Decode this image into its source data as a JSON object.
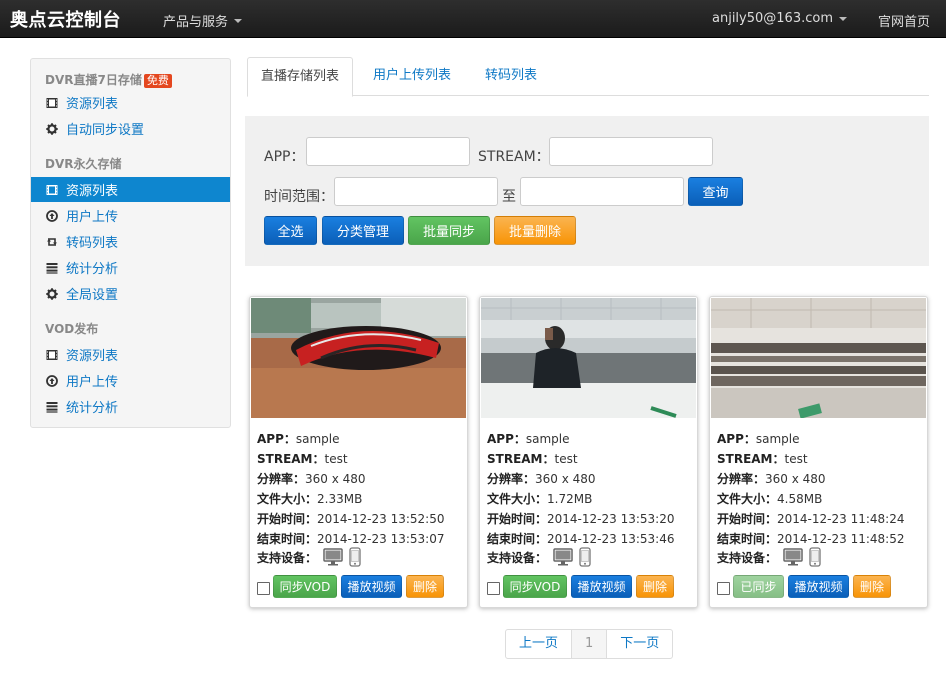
{
  "nav": {
    "brand": "奥点云控制台",
    "products": "产品与服务",
    "user": "anjily50@163.com",
    "home": "官网首页"
  },
  "sidebar": {
    "dvr7_header": "DVR直播7日存储",
    "dvr7_badge": "免费",
    "dvr7_items": [
      {
        "label": "资源列表",
        "icon": "film-icon"
      },
      {
        "label": "自动同步设置",
        "icon": "gear-icon"
      }
    ],
    "dvr_perm_header": "DVR永久存储",
    "dvr_perm_items": [
      {
        "label": "资源列表",
        "icon": "film-icon",
        "active": true
      },
      {
        "label": "用户上传",
        "icon": "upload-circle-icon"
      },
      {
        "label": "转码列表",
        "icon": "retweet-icon"
      },
      {
        "label": "统计分析",
        "icon": "list-icon"
      },
      {
        "label": "全局设置",
        "icon": "gear-icon"
      }
    ],
    "vod_header": "VOD发布",
    "vod_items": [
      {
        "label": "资源列表",
        "icon": "film-icon"
      },
      {
        "label": "用户上传",
        "icon": "upload-circle-icon"
      },
      {
        "label": "统计分析",
        "icon": "list-icon"
      }
    ]
  },
  "tabs": [
    "直播存储列表",
    "用户上传列表",
    "转码列表"
  ],
  "filter": {
    "app_label": "APP：",
    "stream_label": "STREAM：",
    "time_label": "时间范围：",
    "to_label": "至",
    "app_value": "",
    "stream_value": "",
    "time_from": "",
    "time_to": "",
    "query": "查询",
    "select_all": "全选",
    "category": "分类管理",
    "batch_sync": "批量同步",
    "batch_delete": "批量删除"
  },
  "card_labels": {
    "app": "APP：",
    "stream": "STREAM：",
    "resolution": "分辨率：",
    "size": "文件大小：",
    "start": "开始时间：",
    "end": "结束时间：",
    "devices": "支持设备："
  },
  "cards": [
    {
      "app": "sample",
      "stream": "test",
      "resolution": "360 x 480",
      "size": "2.33MB",
      "start": "2014-12-23 13:52:50",
      "end": "2014-12-23 13:53:07",
      "sync": "同步VOD",
      "play": "播放视频",
      "delete": "删除",
      "synced": false
    },
    {
      "app": "sample",
      "stream": "test",
      "resolution": "360 x 480",
      "size": "1.72MB",
      "start": "2014-12-23 13:53:20",
      "end": "2014-12-23 13:53:46",
      "sync": "同步VOD",
      "play": "播放视频",
      "delete": "删除",
      "synced": false
    },
    {
      "app": "sample",
      "stream": "test",
      "resolution": "360 x 480",
      "size": "4.58MB",
      "start": "2014-12-23 11:48:24",
      "end": "2014-12-23 11:48:52",
      "sync": "已同步",
      "play": "播放视频",
      "delete": "删除",
      "synced": true
    }
  ],
  "pager": {
    "prev": "上一页",
    "current": "1",
    "next": "下一页"
  },
  "colors": {
    "accent": "#0e86cf",
    "nav_bg": "#222222",
    "btn_blue": "#0b6fd0",
    "btn_green": "#5bb75b",
    "btn_orange": "#f89406",
    "badge": "#e4471f"
  }
}
